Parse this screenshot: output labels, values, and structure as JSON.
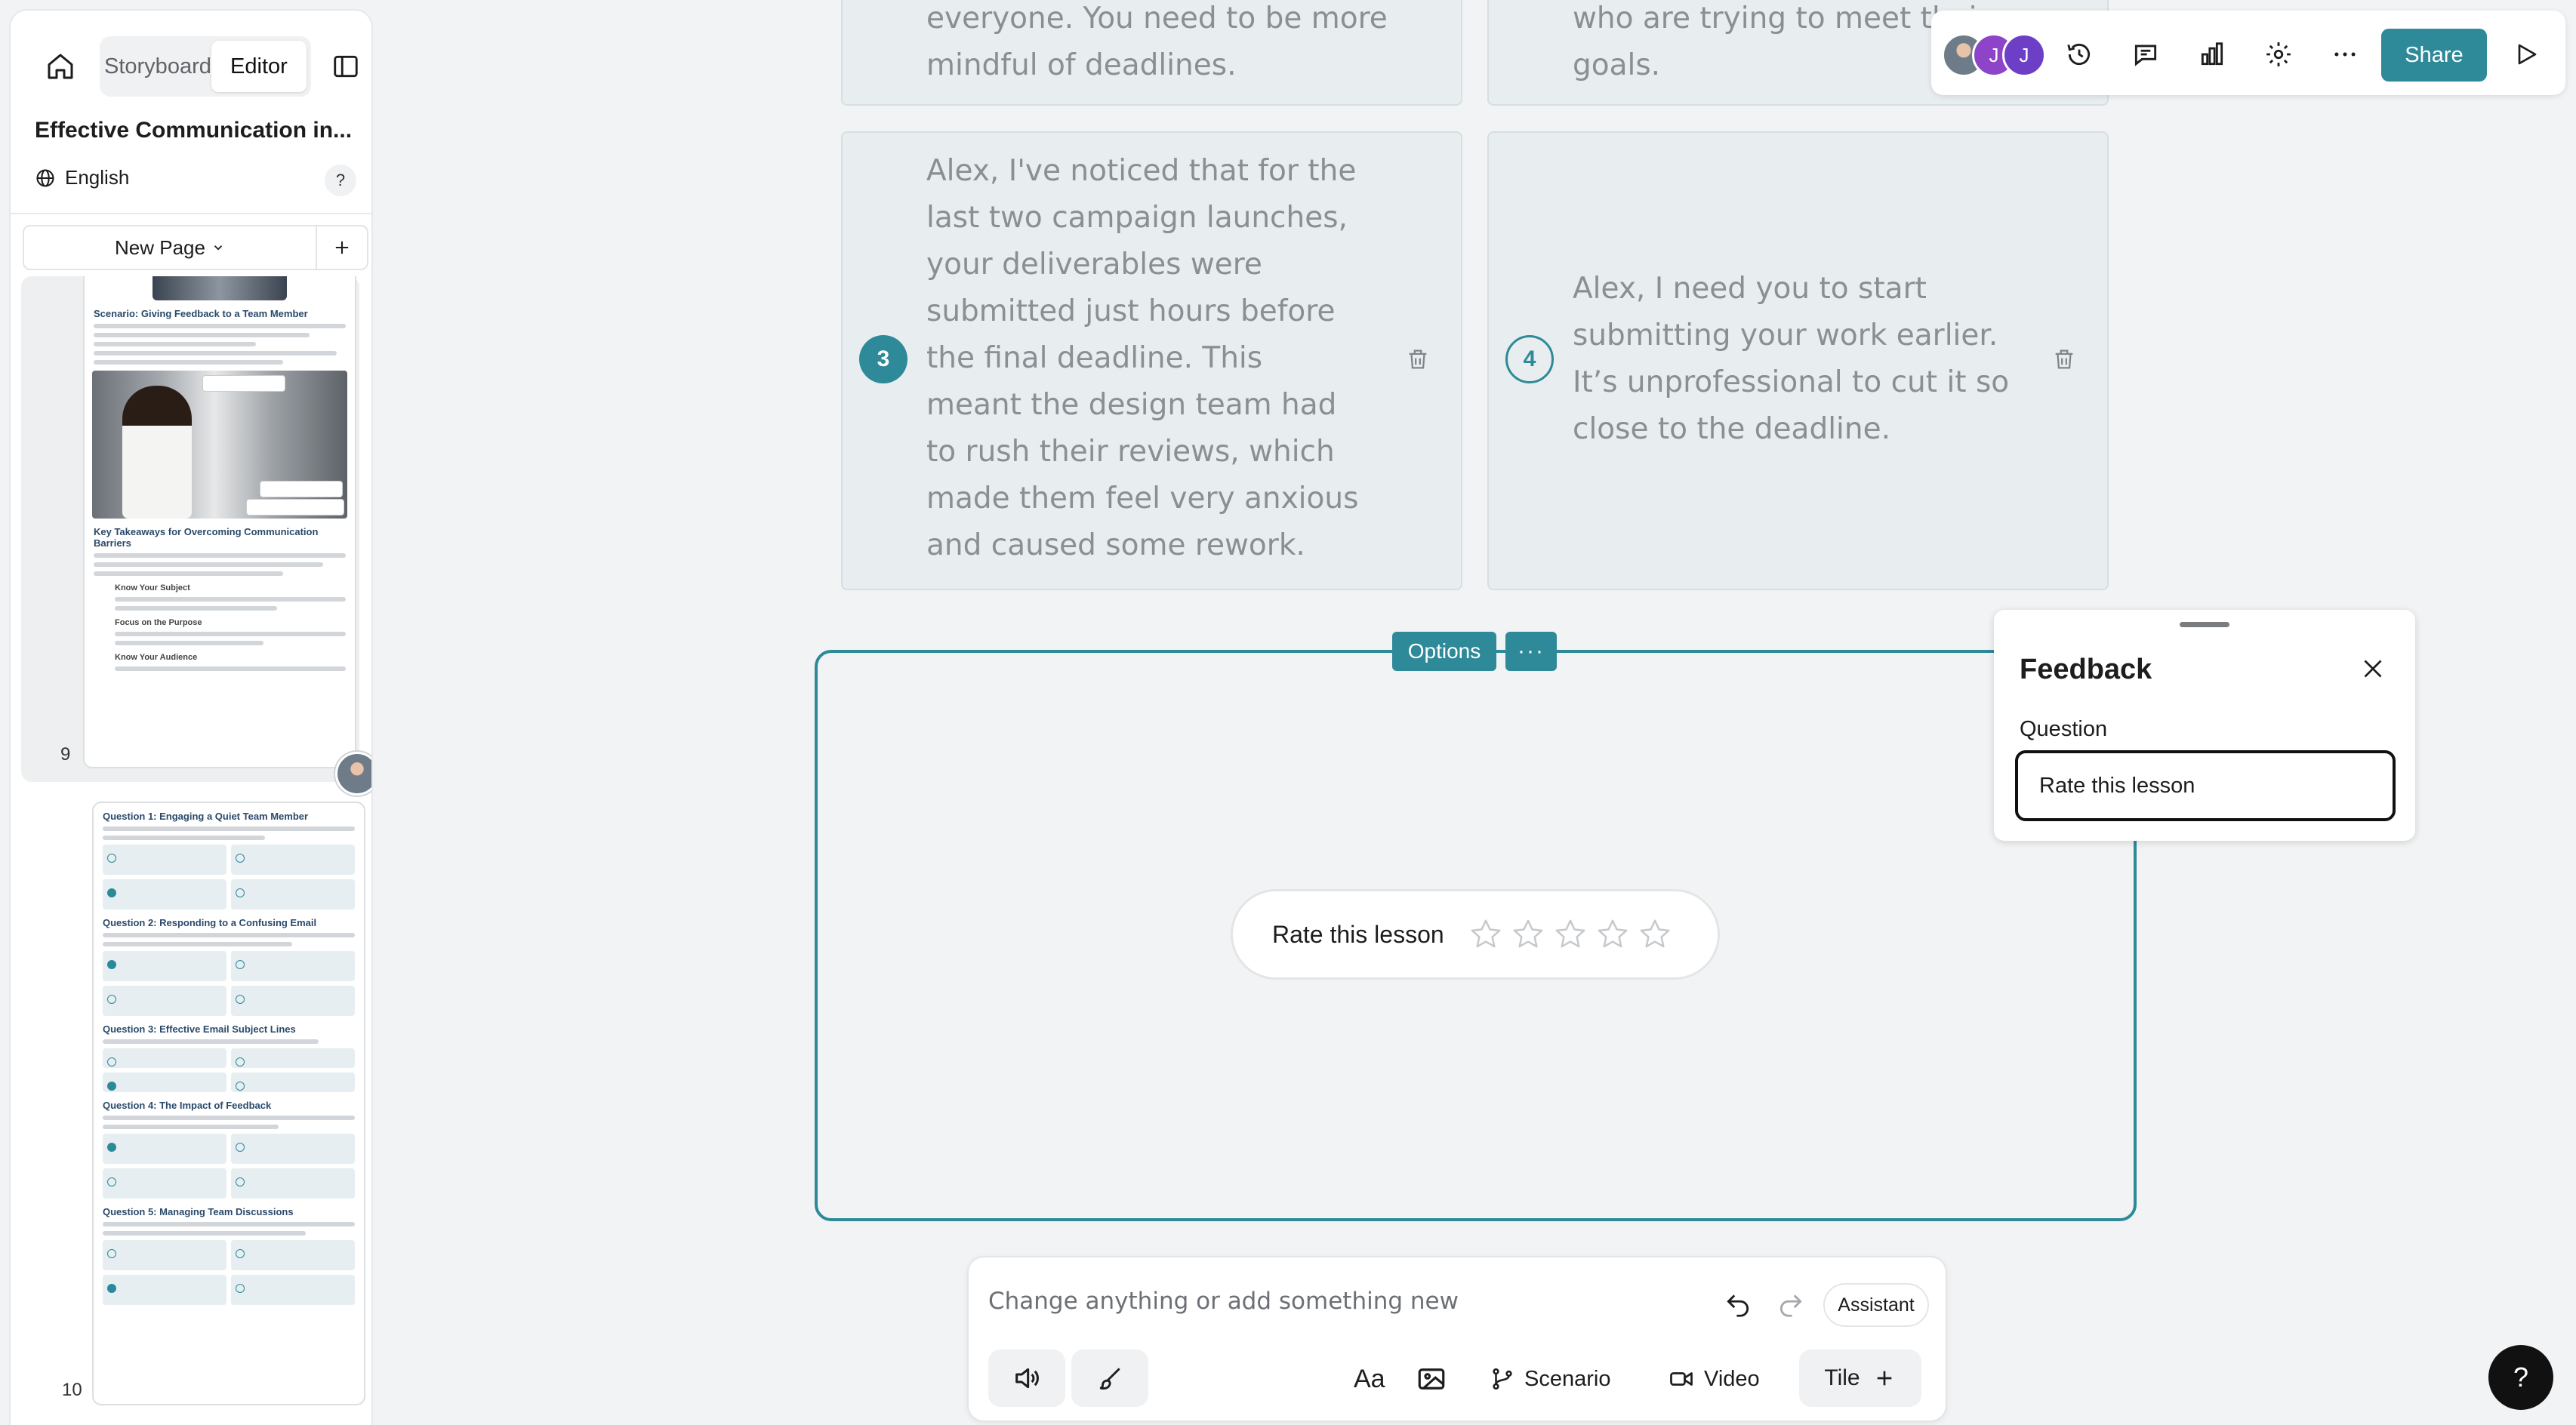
{
  "sidebar": {
    "tabs": [
      {
        "label": "Storyboard",
        "active": false
      },
      {
        "label": "Editor",
        "active": true
      }
    ],
    "doc_title": "Effective Communication in...",
    "language": "English",
    "help": "?",
    "new_page_label": "New Page",
    "pages": [
      {
        "number": "9",
        "headings": [
          "Scenario: Giving Feedback to a Team Member",
          "Key Takeaways for Overcoming Communication Barriers"
        ],
        "subheadings": [
          "Know Your Subject",
          "Focus on the Purpose",
          "Know Your Audience"
        ]
      },
      {
        "number": "10",
        "questions": [
          "Question 1: Engaging a Quiet Team Member",
          "Question 2: Responding to a Confusing Email",
          "Question 3: Effective Email Subject Lines",
          "Question 4: The Impact of Feedback",
          "Question 5: Managing Team Discussions"
        ]
      }
    ]
  },
  "canvas": {
    "cards": [
      {
        "text": "everyone. You need to be more mindful of deadlines."
      },
      {
        "text": "who are trying to meet their goals."
      },
      {
        "number": "3",
        "text": "Alex, I've noticed that for the last two campaign launches, your deliverables were submitted just hours before the final deadline. This meant the design team had to rush their reviews, which made them feel very anxious and caused some rework."
      },
      {
        "number": "4",
        "text": "Alex, I need you to start submitting your work earlier. It’s unprofessional to cut it so close to the deadline."
      }
    ],
    "block_options_label": "Options",
    "block_more_label": "···",
    "rating": {
      "label": "Rate this lesson",
      "stars": 5,
      "value": 0
    }
  },
  "toolbar": {
    "avatars": [
      {
        "initial": "",
        "color": "#7b8794"
      },
      {
        "initial": "J",
        "color": "#8e44c8"
      },
      {
        "initial": "J",
        "color": "#6d3fc7"
      }
    ],
    "share_label": "Share"
  },
  "feedback_panel": {
    "title": "Feedback",
    "question_label": "Question",
    "question_value": "Rate this lesson"
  },
  "composer": {
    "placeholder": "Change anything or add something new",
    "assistant_label": "Assistant",
    "scenario_label": "Scenario",
    "video_label": "Video",
    "tile_label": "Tile",
    "text_tool_label": "Aa"
  },
  "help_fab": "?",
  "colors": {
    "accent": "#2e8a98",
    "card_bg": "#e8edef",
    "canvas_bg": "#f1f3f4"
  }
}
